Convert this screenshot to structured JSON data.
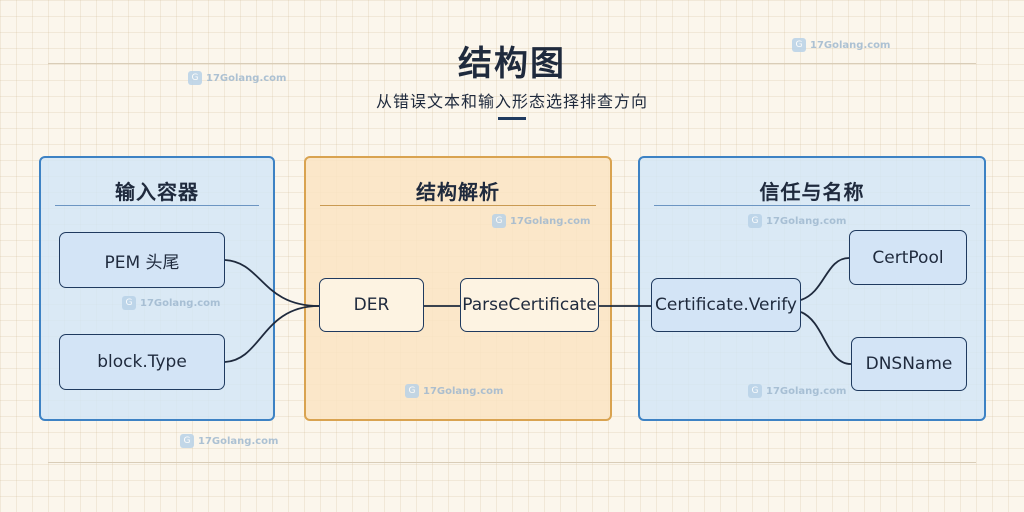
{
  "header": {
    "title": "结构图",
    "subtitle": "从错误文本和输入形态选择排查方向"
  },
  "panels": [
    {
      "id": "input",
      "title": "输入容器",
      "color": "#3d82c4"
    },
    {
      "id": "parse",
      "title": "结构解析",
      "color": "#d9a350"
    },
    {
      "id": "trust",
      "title": "信任与名称",
      "color": "#3d82c4"
    }
  ],
  "nodes": {
    "pem": "PEM 头尾",
    "block_type": "block.Type",
    "der": "DER",
    "parse_certificate": "ParseCertificate",
    "verify": "Certificate.Verify",
    "certpool": "CertPool",
    "dnsname": "DNSName"
  },
  "edges": [
    {
      "from": "pem",
      "to": "der"
    },
    {
      "from": "block_type",
      "to": "der"
    },
    {
      "from": "der",
      "to": "parse_certificate"
    },
    {
      "from": "parse_certificate",
      "to": "verify"
    },
    {
      "from": "verify",
      "to": "certpool"
    },
    {
      "from": "verify",
      "to": "dnsname"
    }
  ],
  "watermark": {
    "text": "17Golang.com",
    "icon": "golang-logo-icon"
  }
}
